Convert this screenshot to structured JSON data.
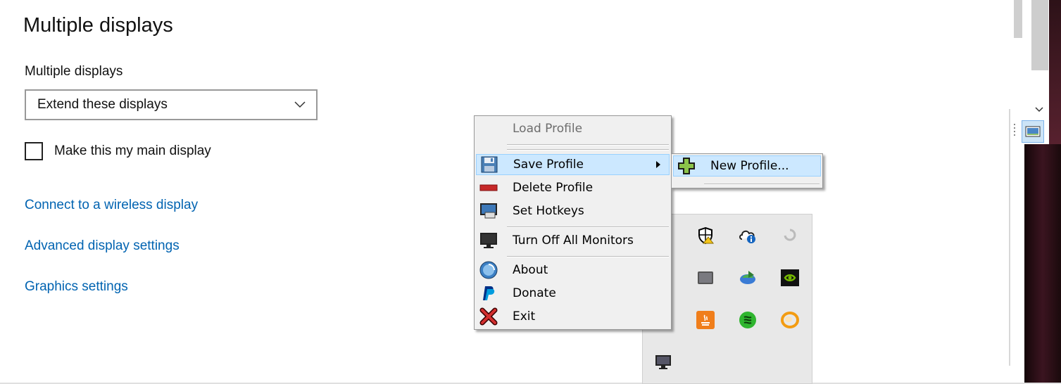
{
  "section": {
    "title": "Multiple displays",
    "dropdown_label": "Multiple displays",
    "dropdown_value": "Extend these displays",
    "checkbox_label": "Make this my main display",
    "links": {
      "wireless": "Connect to a wireless display",
      "advanced": "Advanced display settings",
      "graphics": "Graphics settings"
    }
  },
  "context_menu": {
    "items": {
      "load": "Load Profile",
      "save": "Save Profile",
      "delete": "Delete Profile",
      "hotkeys": "Set Hotkeys",
      "turn_off": "Turn Off All Monitors",
      "about": "About",
      "donate": "Donate",
      "exit": "Exit"
    },
    "submenu": {
      "new_profile": "New Profile..."
    }
  },
  "colors": {
    "link": "#0063b1",
    "highlight": "#cce8ff",
    "menu_bg": "#f0f0f0"
  }
}
